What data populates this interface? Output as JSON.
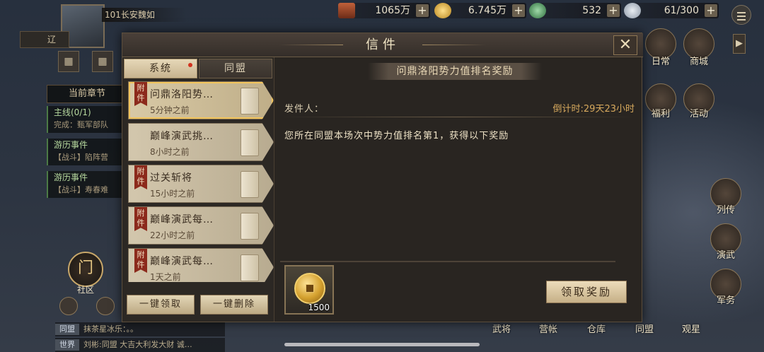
{
  "resources": [
    {
      "value": "1065万",
      "icon": "ingot-icon"
    },
    {
      "value": "6.745万",
      "icon": "gold-coin-icon"
    },
    {
      "value": "532",
      "icon": "jade-icon"
    },
    {
      "value": "61/300",
      "icon": "cloud-icon"
    }
  ],
  "plus_label": "+",
  "player": {
    "name": "101长安魏如"
  },
  "hud_left": {
    "flag_label": "辽",
    "chapter_title": "当前章节",
    "quests": [
      {
        "title": "主线(0/1)",
        "sub": "完成：甄军部队"
      },
      {
        "title": "游历事件",
        "sub": "【战斗】陷阵营"
      },
      {
        "title": "游历事件",
        "sub": "【战斗】寿春难"
      }
    ],
    "community_icon": "门",
    "community_label": "社区"
  },
  "hud_right": {
    "items": [
      {
        "label": "日常",
        "icon": "daily-icon"
      },
      {
        "label": "商城",
        "icon": "shop-icon"
      },
      {
        "label": "福利",
        "icon": "welfare-icon"
      },
      {
        "label": "活动",
        "icon": "event-icon"
      },
      {
        "label": "列传",
        "icon": "biography-icon"
      },
      {
        "label": "演武",
        "icon": "arena-icon"
      },
      {
        "label": "军务",
        "icon": "military-icon"
      }
    ]
  },
  "bottom_nav": [
    "武将",
    "营帐",
    "仓库",
    "同盟",
    "观星"
  ],
  "chat": [
    {
      "channel": "同盟",
      "text": "抹茶星冰乐：。。"
    },
    {
      "channel": "世界",
      "text": "刘彬:同盟 大吉大利发大财 诚…"
    }
  ],
  "dialog": {
    "title": "信件",
    "close": "✕",
    "tabs": [
      {
        "label": "系统"
      },
      {
        "label": "同盟"
      }
    ],
    "mails": [
      {
        "subject": "问鼎洛阳势…",
        "time": "5分钟之前",
        "attachment": "附件"
      },
      {
        "subject": "巅峰演武挑…",
        "time": "8小时之前",
        "attachment": ""
      },
      {
        "subject": "过关斩将",
        "time": "15小时之前",
        "attachment": "附件"
      },
      {
        "subject": "巅峰演武每…",
        "time": "22小时之前",
        "attachment": "附件"
      },
      {
        "subject": "巅峰演武每…",
        "time": "1天之前",
        "attachment": "附件"
      }
    ],
    "buttons": {
      "claim_all": "一键领取",
      "delete_all": "一键删除"
    },
    "detail": {
      "subject": "问鼎洛阳势力值排名奖励",
      "sender": "发件人：",
      "countdown": "倒计时:29天23小时",
      "body": "您所在同盟本场次中势力值排名第1，获得以下奖励",
      "reward_icon": "copper-coin-icon",
      "reward_qty": "1500",
      "claim_label": "领取奖励"
    }
  }
}
